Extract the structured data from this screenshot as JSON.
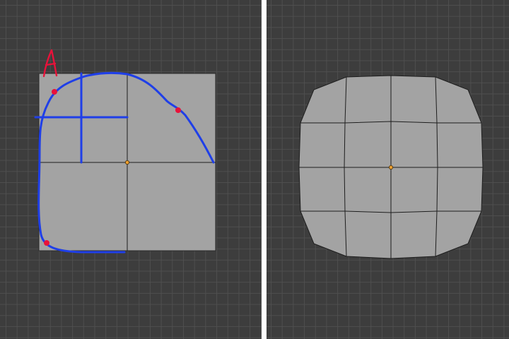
{
  "left_view": {
    "annotation_label": "A",
    "colors": {
      "mesh_face": "#a3a3a3",
      "mesh_edge": "#1e1e1e",
      "pivot": "#f0a030",
      "annotation_stroke": "#1f3fe8",
      "annotation_points": "#e8123a",
      "annotation_label": "#e8123a"
    }
  },
  "right_view": {
    "colors": {
      "mesh_face": "#a3a3a3",
      "mesh_edge": "#1e1e1e",
      "pivot": "#f0a030"
    }
  },
  "divider_color": "#ffffff"
}
